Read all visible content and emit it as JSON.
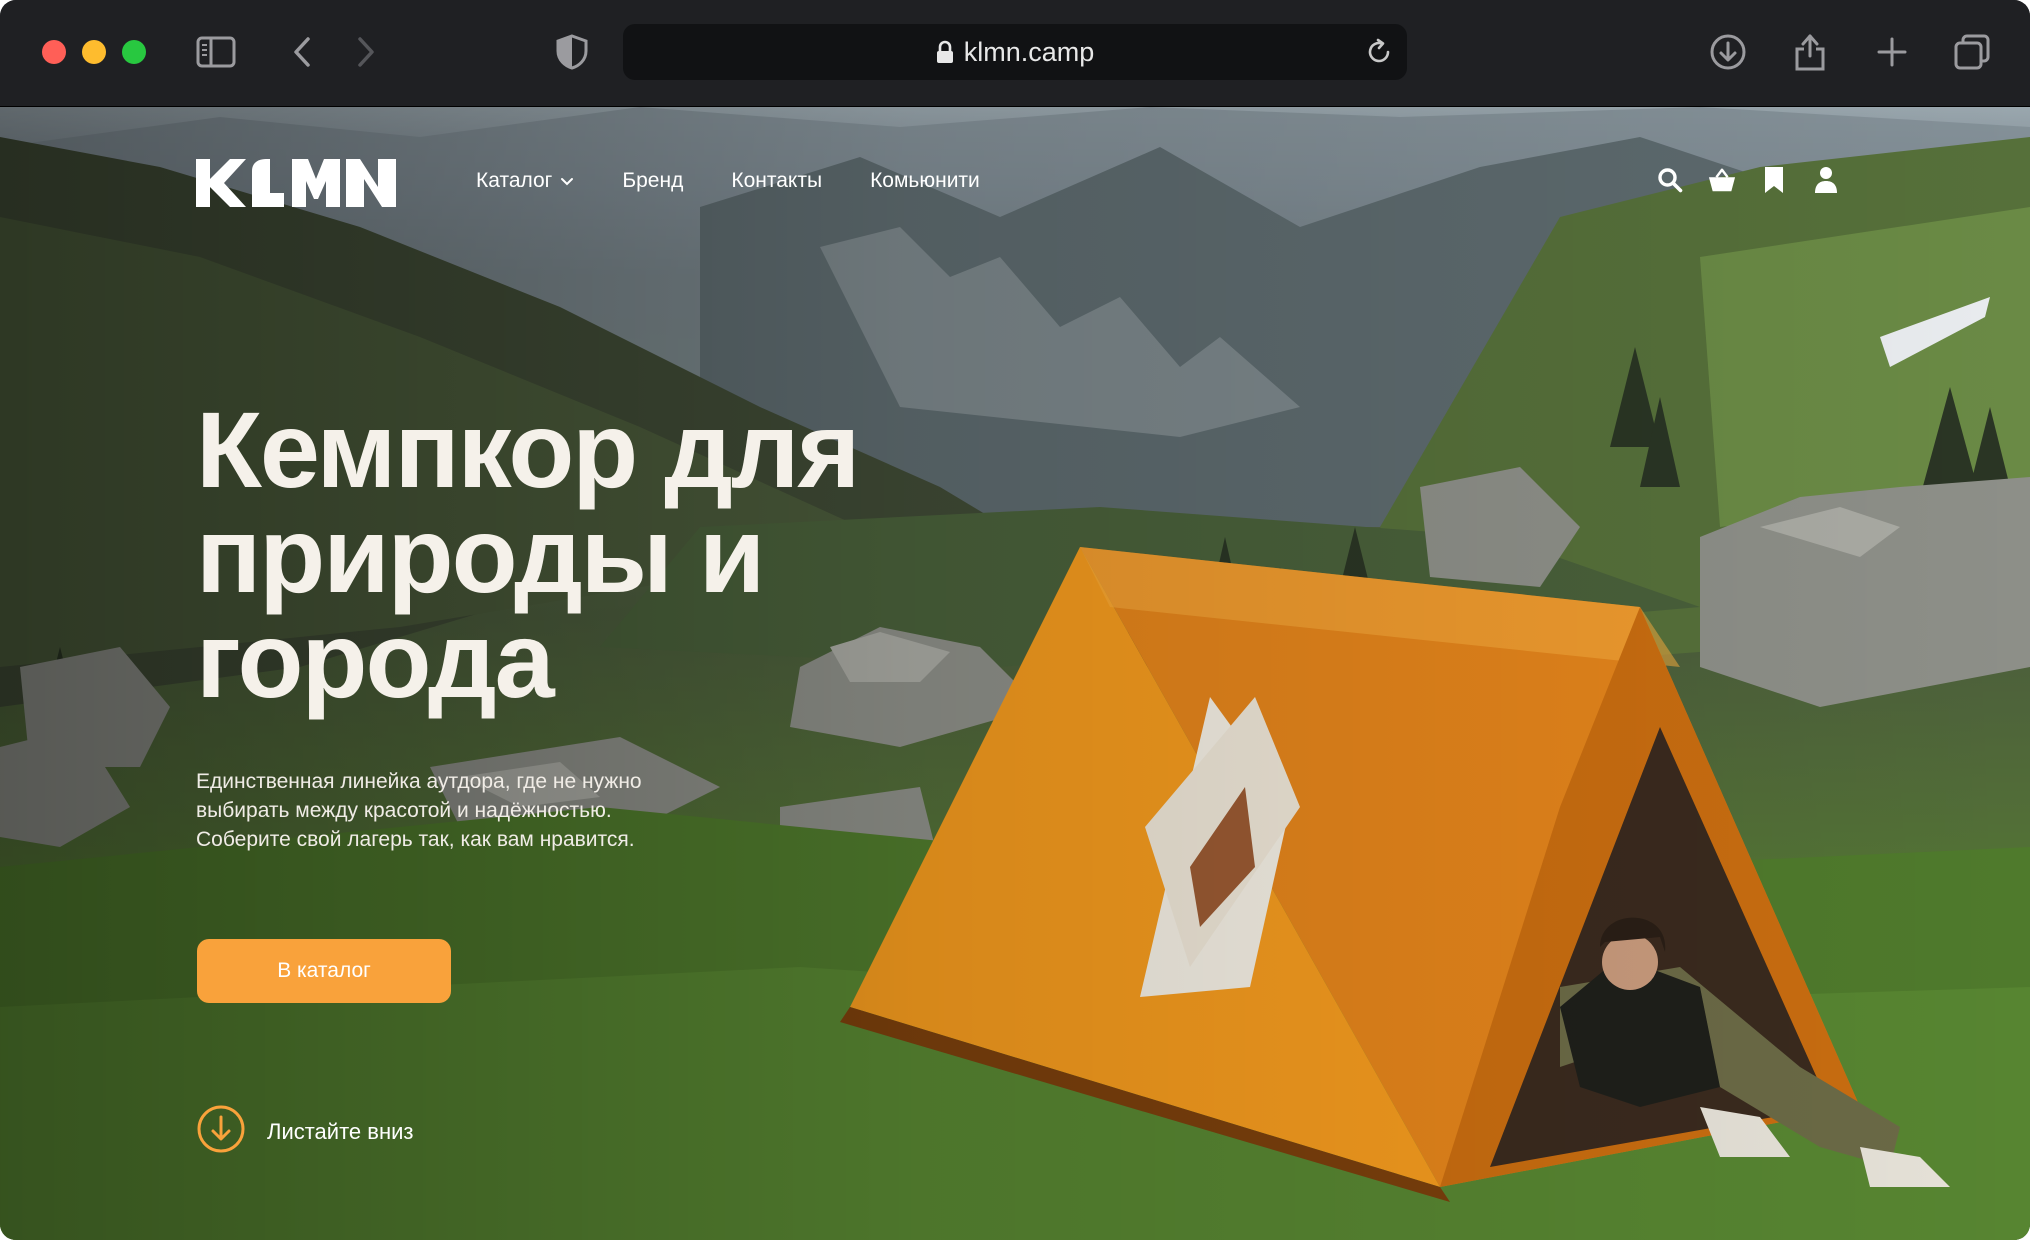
{
  "browser": {
    "url": "klmn.camp"
  },
  "site": {
    "logo_text": "KLMN",
    "nav": {
      "catalog": "Каталог",
      "brand": "Бренд",
      "contacts": "Контакты",
      "community": "Комьюнити"
    },
    "hero": {
      "headline_line1": "Кемпкор для",
      "headline_line2": "природы и",
      "headline_line3": "города",
      "lead_line1": "Единственная линейка аутдора, где не нужно",
      "lead_line2": "выбирать между красотой и надёжностью.",
      "lead_line3": "Соберите свой лагерь так, как вам нравится.",
      "cta_label": "В каталог",
      "scroll_label": "Листайте вниз"
    }
  },
  "colors": {
    "accent": "#f9a23b",
    "tent_orange": "#f39a1e",
    "chrome_bg": "#1f2023"
  },
  "icons": {
    "sidebar": "sidebar-toggle-icon",
    "back": "chevron-left-icon",
    "forward": "chevron-right-icon",
    "shield": "shield-icon",
    "lock": "lock-icon",
    "reload": "reload-icon",
    "download": "download-icon",
    "share": "share-icon",
    "new_tab": "plus-icon",
    "tabs": "tabs-overview-icon",
    "search": "search-icon",
    "basket": "basket-icon",
    "bookmark": "bookmark-icon",
    "profile": "user-icon",
    "scroll_down": "arrow-down-circle-icon"
  }
}
